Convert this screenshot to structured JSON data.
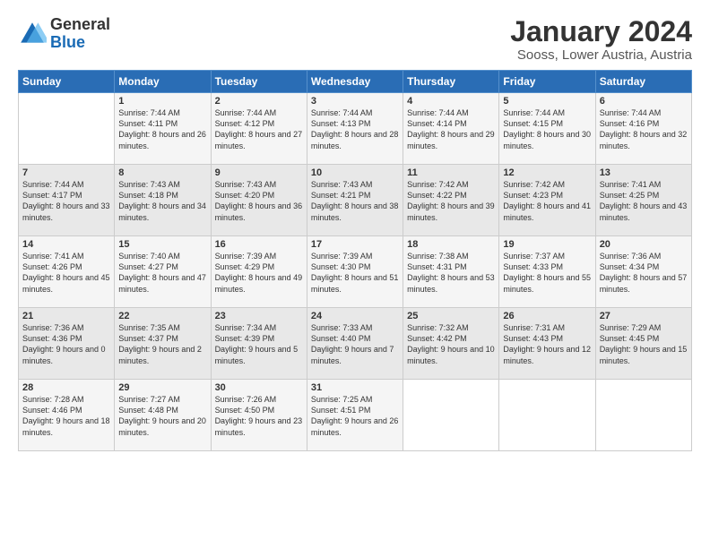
{
  "header": {
    "logo_line1": "General",
    "logo_line2": "Blue",
    "main_title": "January 2024",
    "subtitle": "Sooss, Lower Austria, Austria"
  },
  "calendar": {
    "weekdays": [
      "Sunday",
      "Monday",
      "Tuesday",
      "Wednesday",
      "Thursday",
      "Friday",
      "Saturday"
    ],
    "weeks": [
      [
        {
          "day": "",
          "sunrise": "",
          "sunset": "",
          "daylight": ""
        },
        {
          "day": "1",
          "sunrise": "Sunrise: 7:44 AM",
          "sunset": "Sunset: 4:11 PM",
          "daylight": "Daylight: 8 hours and 26 minutes."
        },
        {
          "day": "2",
          "sunrise": "Sunrise: 7:44 AM",
          "sunset": "Sunset: 4:12 PM",
          "daylight": "Daylight: 8 hours and 27 minutes."
        },
        {
          "day": "3",
          "sunrise": "Sunrise: 7:44 AM",
          "sunset": "Sunset: 4:13 PM",
          "daylight": "Daylight: 8 hours and 28 minutes."
        },
        {
          "day": "4",
          "sunrise": "Sunrise: 7:44 AM",
          "sunset": "Sunset: 4:14 PM",
          "daylight": "Daylight: 8 hours and 29 minutes."
        },
        {
          "day": "5",
          "sunrise": "Sunrise: 7:44 AM",
          "sunset": "Sunset: 4:15 PM",
          "daylight": "Daylight: 8 hours and 30 minutes."
        },
        {
          "day": "6",
          "sunrise": "Sunrise: 7:44 AM",
          "sunset": "Sunset: 4:16 PM",
          "daylight": "Daylight: 8 hours and 32 minutes."
        }
      ],
      [
        {
          "day": "7",
          "sunrise": "Sunrise: 7:44 AM",
          "sunset": "Sunset: 4:17 PM",
          "daylight": "Daylight: 8 hours and 33 minutes."
        },
        {
          "day": "8",
          "sunrise": "Sunrise: 7:43 AM",
          "sunset": "Sunset: 4:18 PM",
          "daylight": "Daylight: 8 hours and 34 minutes."
        },
        {
          "day": "9",
          "sunrise": "Sunrise: 7:43 AM",
          "sunset": "Sunset: 4:20 PM",
          "daylight": "Daylight: 8 hours and 36 minutes."
        },
        {
          "day": "10",
          "sunrise": "Sunrise: 7:43 AM",
          "sunset": "Sunset: 4:21 PM",
          "daylight": "Daylight: 8 hours and 38 minutes."
        },
        {
          "day": "11",
          "sunrise": "Sunrise: 7:42 AM",
          "sunset": "Sunset: 4:22 PM",
          "daylight": "Daylight: 8 hours and 39 minutes."
        },
        {
          "day": "12",
          "sunrise": "Sunrise: 7:42 AM",
          "sunset": "Sunset: 4:23 PM",
          "daylight": "Daylight: 8 hours and 41 minutes."
        },
        {
          "day": "13",
          "sunrise": "Sunrise: 7:41 AM",
          "sunset": "Sunset: 4:25 PM",
          "daylight": "Daylight: 8 hours and 43 minutes."
        }
      ],
      [
        {
          "day": "14",
          "sunrise": "Sunrise: 7:41 AM",
          "sunset": "Sunset: 4:26 PM",
          "daylight": "Daylight: 8 hours and 45 minutes."
        },
        {
          "day": "15",
          "sunrise": "Sunrise: 7:40 AM",
          "sunset": "Sunset: 4:27 PM",
          "daylight": "Daylight: 8 hours and 47 minutes."
        },
        {
          "day": "16",
          "sunrise": "Sunrise: 7:39 AM",
          "sunset": "Sunset: 4:29 PM",
          "daylight": "Daylight: 8 hours and 49 minutes."
        },
        {
          "day": "17",
          "sunrise": "Sunrise: 7:39 AM",
          "sunset": "Sunset: 4:30 PM",
          "daylight": "Daylight: 8 hours and 51 minutes."
        },
        {
          "day": "18",
          "sunrise": "Sunrise: 7:38 AM",
          "sunset": "Sunset: 4:31 PM",
          "daylight": "Daylight: 8 hours and 53 minutes."
        },
        {
          "day": "19",
          "sunrise": "Sunrise: 7:37 AM",
          "sunset": "Sunset: 4:33 PM",
          "daylight": "Daylight: 8 hours and 55 minutes."
        },
        {
          "day": "20",
          "sunrise": "Sunrise: 7:36 AM",
          "sunset": "Sunset: 4:34 PM",
          "daylight": "Daylight: 8 hours and 57 minutes."
        }
      ],
      [
        {
          "day": "21",
          "sunrise": "Sunrise: 7:36 AM",
          "sunset": "Sunset: 4:36 PM",
          "daylight": "Daylight: 9 hours and 0 minutes."
        },
        {
          "day": "22",
          "sunrise": "Sunrise: 7:35 AM",
          "sunset": "Sunset: 4:37 PM",
          "daylight": "Daylight: 9 hours and 2 minutes."
        },
        {
          "day": "23",
          "sunrise": "Sunrise: 7:34 AM",
          "sunset": "Sunset: 4:39 PM",
          "daylight": "Daylight: 9 hours and 5 minutes."
        },
        {
          "day": "24",
          "sunrise": "Sunrise: 7:33 AM",
          "sunset": "Sunset: 4:40 PM",
          "daylight": "Daylight: 9 hours and 7 minutes."
        },
        {
          "day": "25",
          "sunrise": "Sunrise: 7:32 AM",
          "sunset": "Sunset: 4:42 PM",
          "daylight": "Daylight: 9 hours and 10 minutes."
        },
        {
          "day": "26",
          "sunrise": "Sunrise: 7:31 AM",
          "sunset": "Sunset: 4:43 PM",
          "daylight": "Daylight: 9 hours and 12 minutes."
        },
        {
          "day": "27",
          "sunrise": "Sunrise: 7:29 AM",
          "sunset": "Sunset: 4:45 PM",
          "daylight": "Daylight: 9 hours and 15 minutes."
        }
      ],
      [
        {
          "day": "28",
          "sunrise": "Sunrise: 7:28 AM",
          "sunset": "Sunset: 4:46 PM",
          "daylight": "Daylight: 9 hours and 18 minutes."
        },
        {
          "day": "29",
          "sunrise": "Sunrise: 7:27 AM",
          "sunset": "Sunset: 4:48 PM",
          "daylight": "Daylight: 9 hours and 20 minutes."
        },
        {
          "day": "30",
          "sunrise": "Sunrise: 7:26 AM",
          "sunset": "Sunset: 4:50 PM",
          "daylight": "Daylight: 9 hours and 23 minutes."
        },
        {
          "day": "31",
          "sunrise": "Sunrise: 7:25 AM",
          "sunset": "Sunset: 4:51 PM",
          "daylight": "Daylight: 9 hours and 26 minutes."
        },
        {
          "day": "",
          "sunrise": "",
          "sunset": "",
          "daylight": ""
        },
        {
          "day": "",
          "sunrise": "",
          "sunset": "",
          "daylight": ""
        },
        {
          "day": "",
          "sunrise": "",
          "sunset": "",
          "daylight": ""
        }
      ]
    ]
  }
}
